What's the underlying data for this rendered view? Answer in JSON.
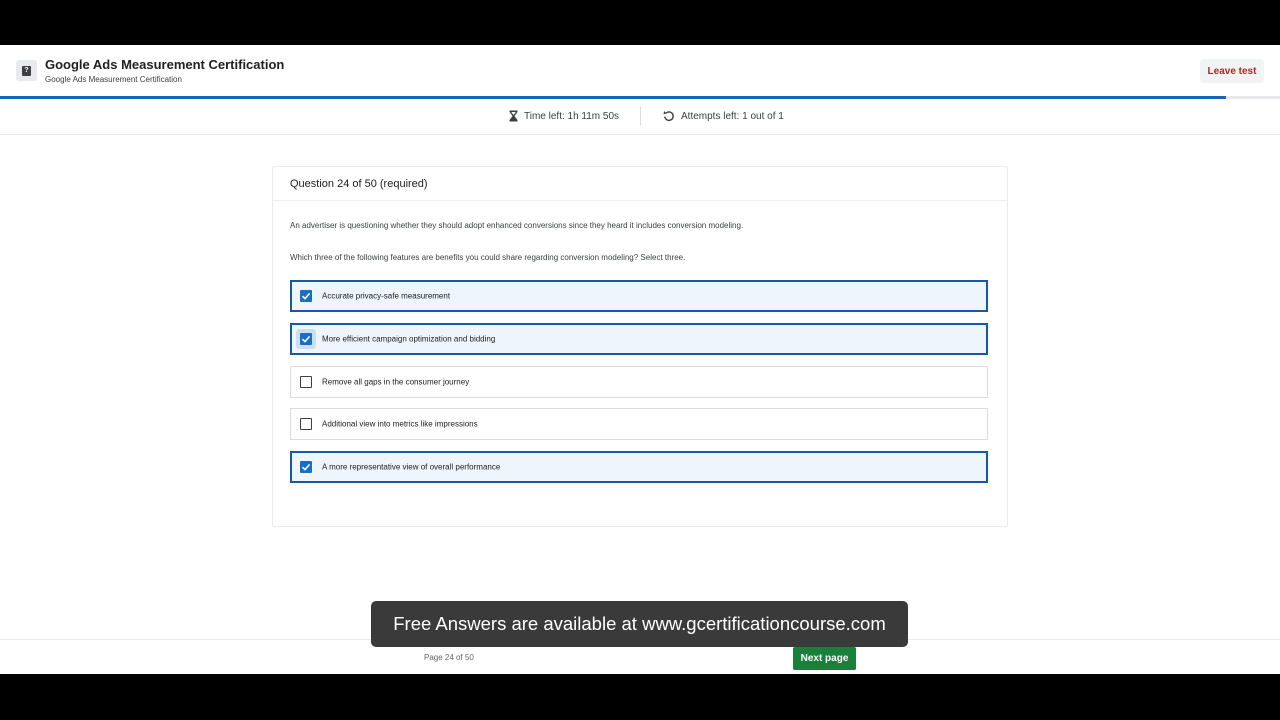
{
  "header": {
    "title": "Google Ads Measurement Certification",
    "subtitle": "Google Ads Measurement Certification",
    "leave_label": "Leave test",
    "progress_fraction": 0.958
  },
  "status": {
    "time_left": "Time left: 1h 11m 50s",
    "attempts_left": "Attempts left: 1 out of 1"
  },
  "question": {
    "number_label": "Question 24 of 50 (required)",
    "text_1": "An advertiser is questioning whether they should adopt enhanced conversions since they heard it includes conversion modeling.",
    "text_2": "Which three of the following features are benefits you could share regarding conversion modeling? Select three.",
    "options": [
      {
        "label": "Accurate privacy-safe measurement",
        "checked": true
      },
      {
        "label": "More efficient campaign optimization and bidding",
        "checked": true
      },
      {
        "label": "Remove all gaps in the consumer journey",
        "checked": false
      },
      {
        "label": "Additional view into metrics like impressions",
        "checked": false
      },
      {
        "label": "A more representative view of overall performance",
        "checked": true
      }
    ]
  },
  "banner": {
    "text": "Free Answers are available at www.gcertificationcourse.com"
  },
  "footer": {
    "page_label": "Page 24 of 50",
    "next_label": "Next page"
  },
  "colors": {
    "accent": "#1a6ec4",
    "next_button": "#188038",
    "leave_text": "#b3261e"
  }
}
